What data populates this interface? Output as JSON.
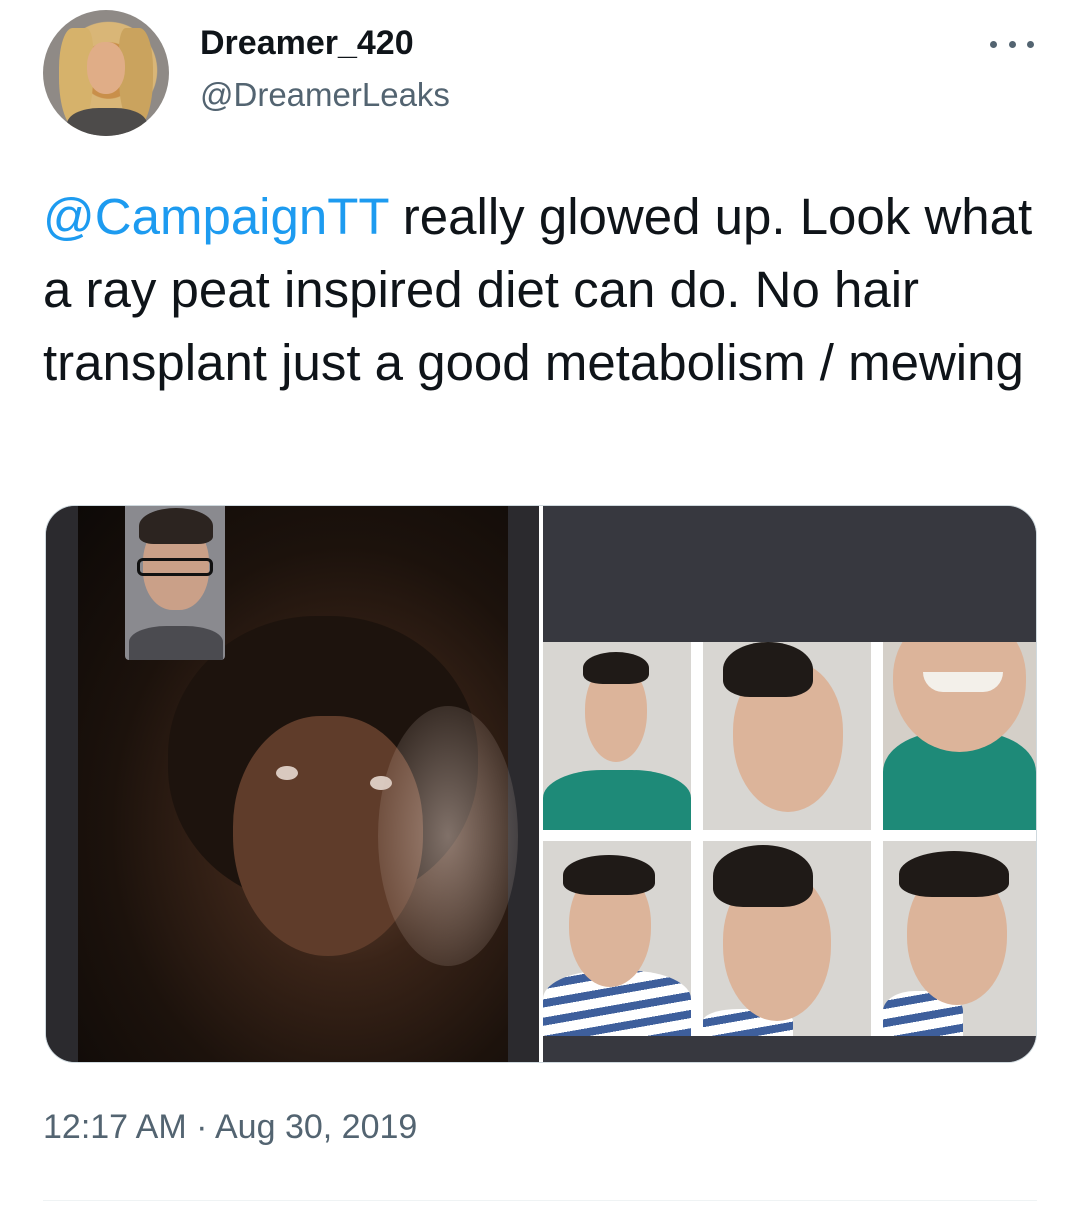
{
  "author": {
    "display_name": "Dreamer_420",
    "handle": "@DreamerLeaks"
  },
  "tweet": {
    "mention": "@CampaignTT",
    "text": " really glowed up. Look what a ray peat inspired diet can do. No hair transplant just a good metabolism / mewing"
  },
  "meta": {
    "time": "12:17 AM",
    "separator": " · ",
    "date": "Aug 30, 2019"
  },
  "icons": {
    "more": "more-horizontal-icon"
  }
}
